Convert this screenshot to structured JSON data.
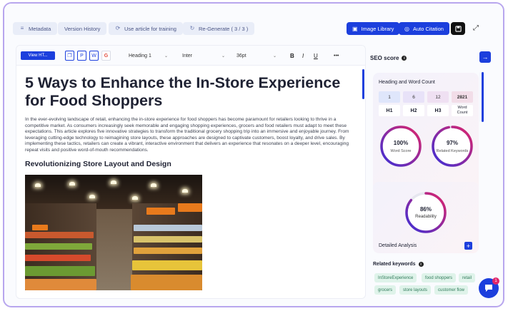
{
  "topbar": {
    "metadata": "Metadata",
    "version_history": "Version History",
    "use_article": "Use article for training",
    "regenerate": "Re-Generate ( 3 / 3 )",
    "image_library": "Image Library",
    "auto_citation": "Auto Citation"
  },
  "toolbar": {
    "view_btn": "View HT...",
    "heading_select": "Heading 1",
    "font_select": "Inter",
    "size_select": "36pt",
    "bold": "B",
    "italic": "I",
    "underline": "U",
    "more": "•••"
  },
  "article": {
    "title": "5 Ways to Enhance the In-Store Experience for Food Shoppers",
    "intro": "In the ever-evolving landscape of retail, enhancing the in-store experience for food shoppers has become paramount for retailers looking to thrive in a competitive market. As consumers increasingly seek memorable and engaging shopping experiences, grocers and food retailers must adapt to meet these expectations. This article explores five innovative strategies to transform the traditional grocery shopping trip into an immersive and enjoyable journey. From leveraging cutting-edge technology to reimagining store layouts, these approaches are designed to captivate customers, boost loyalty, and drive sales. By implementing these tactics, retailers can create a vibrant, interactive environment that delivers an experience that resonates on a deeper level, encouraging repeat visits and positive word-of-mouth recommendations.",
    "section_heading": "Revolutionizing Store Layout and Design"
  },
  "seo": {
    "title": "SEO score",
    "heading_card_title": "Heading and Word Count",
    "headings": [
      {
        "count": "1",
        "label": "H1",
        "color": "#dfe6fb"
      },
      {
        "count": "6",
        "label": "H2",
        "color": "#e8e2f8"
      },
      {
        "count": "12",
        "label": "H3",
        "color": "#efe0f2"
      },
      {
        "count": "2821",
        "label": "Word Count",
        "color": "#f2dde8"
      }
    ],
    "word_score": {
      "value": "100%",
      "label": "Word Score",
      "pct": 100
    },
    "related_score": {
      "value": "97%",
      "label": "Related Keywords",
      "pct": 97
    },
    "readability": {
      "value": "86%",
      "label": "Readability",
      "pct": 86
    },
    "detailed_analysis": "Detailed Analysis",
    "related_keywords_title": "Related keywords",
    "keywords": [
      "InStoreExperience",
      "food shoppers",
      "retail",
      "grocers",
      "store layouts",
      "customer flow"
    ]
  },
  "chat": {
    "badge": "1"
  },
  "colors": {
    "accent": "#1c3fdd",
    "ring_start": "#3a2fd8",
    "ring_end": "#e0246a"
  }
}
